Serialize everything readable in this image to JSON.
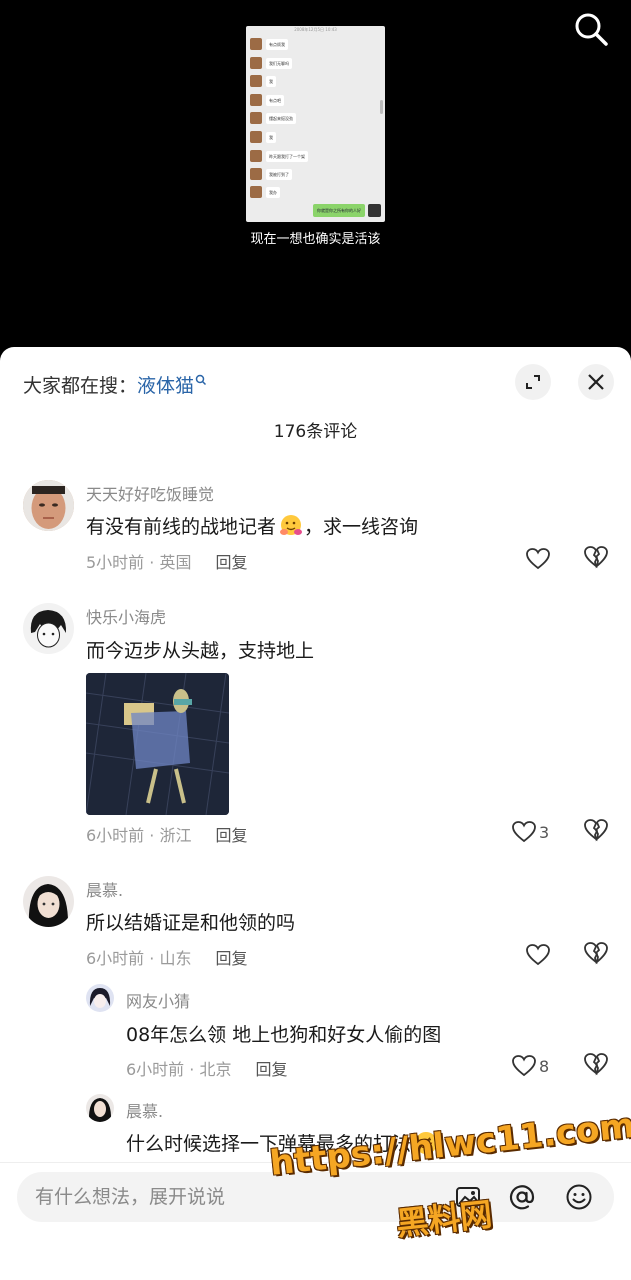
{
  "video": {
    "subtitle": "现在一想也确实是活该",
    "chat_screenshot": {
      "timestamp": "2008年12月5日 10:43",
      "messages": [
        "有点烦我",
        "我们无聊吗",
        "我",
        "有点吧",
        "懂起来挺没劲",
        "我",
        "昨天跟我打了一个架",
        "我被打到了",
        "我办"
      ],
      "my_message": "你就是你之所有你的人好"
    }
  },
  "sheet": {
    "search_prefix": "大家都在搜：",
    "search_keyword": "液体猫",
    "comment_count": "176条评论"
  },
  "comments": [
    {
      "user": "天天好好吃饭睡觉",
      "text": "有没有前线的战地记者",
      "emoji": "hugging-face",
      "text_after": "，求一线咨询",
      "time_loc": "5小时前 · 英国",
      "reply": "回复",
      "likes": ""
    },
    {
      "user": "快乐小海虎",
      "text": "而今迈步从头越，支持地上",
      "time_loc": "6小时前 · 浙江",
      "reply": "回复",
      "likes": "3"
    },
    {
      "user": "晨慕.",
      "text": "所以结婚证是和他领的吗",
      "time_loc": "6小时前 · 山东",
      "reply": "回复",
      "likes": ""
    },
    {
      "user": "网友小猜",
      "text": "08年怎么领  地上也狗和好女人偷的图",
      "time_loc": "6小时前 · 北京",
      "reply": "回复",
      "likes": "8"
    },
    {
      "user": "晨慕.",
      "text": "什么时候选择一下弹幕最多的打法",
      "emoji": "rofl-face"
    }
  ],
  "input": {
    "placeholder": "有什么想法，展开说说"
  },
  "watermark": {
    "url": "https://hlwc11.com",
    "name": "黑料网"
  },
  "colors": {
    "keyword": "#2a65a8",
    "username": "#8a8a8a",
    "meta": "#9a9a9a",
    "watermark": "#f5a623"
  }
}
